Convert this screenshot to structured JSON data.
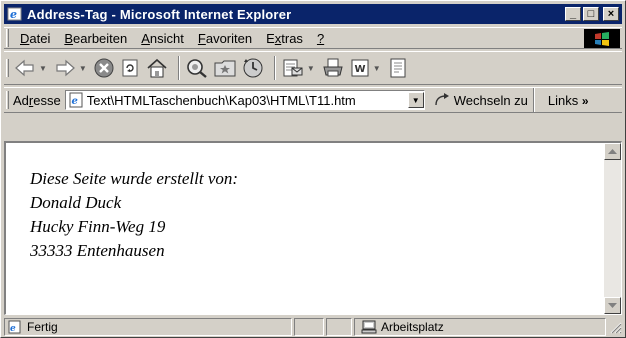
{
  "window": {
    "title": "Address-Tag - Microsoft Internet Explorer",
    "minimize": "_",
    "maximize": "□",
    "close": "×"
  },
  "menu": [
    {
      "underline": "D",
      "rest": "atei"
    },
    {
      "underline": "B",
      "rest": "earbeiten"
    },
    {
      "underline": "A",
      "rest": "nsicht"
    },
    {
      "underline": "F",
      "rest": "avoriten"
    },
    {
      "pre": "E",
      "underline": "x",
      "rest": "tras"
    },
    {
      "underline": "?",
      "rest": ""
    }
  ],
  "toolbar": {
    "icons": [
      "back-icon",
      "forward-icon",
      "stop-icon",
      "refresh-icon",
      "home-icon",
      "search-icon",
      "favorites-icon",
      "history-icon",
      "mail-icon",
      "print-icon",
      "edit-icon",
      "discuss-icon"
    ]
  },
  "address": {
    "label_pre": "Ad",
    "label_u": "r",
    "label_post": "esse",
    "value": "Text\\HTMLTaschenbuch\\Kap03\\HTML\\T11.htm",
    "go_label": "Wechseln zu",
    "links_label": "Links",
    "links_chevron": "»"
  },
  "page": {
    "lines": [
      "Diese Seite wurde erstellt von:",
      "Donald Duck",
      "Hucky Finn-Weg 19",
      "33333 Entenhausen"
    ]
  },
  "status": {
    "text": "Fertig",
    "zone": "Arbeitsplatz"
  },
  "colors": {
    "title_bar": "#0a246a",
    "chrome": "#d4d0c8",
    "content_bg": "#ffffff"
  }
}
